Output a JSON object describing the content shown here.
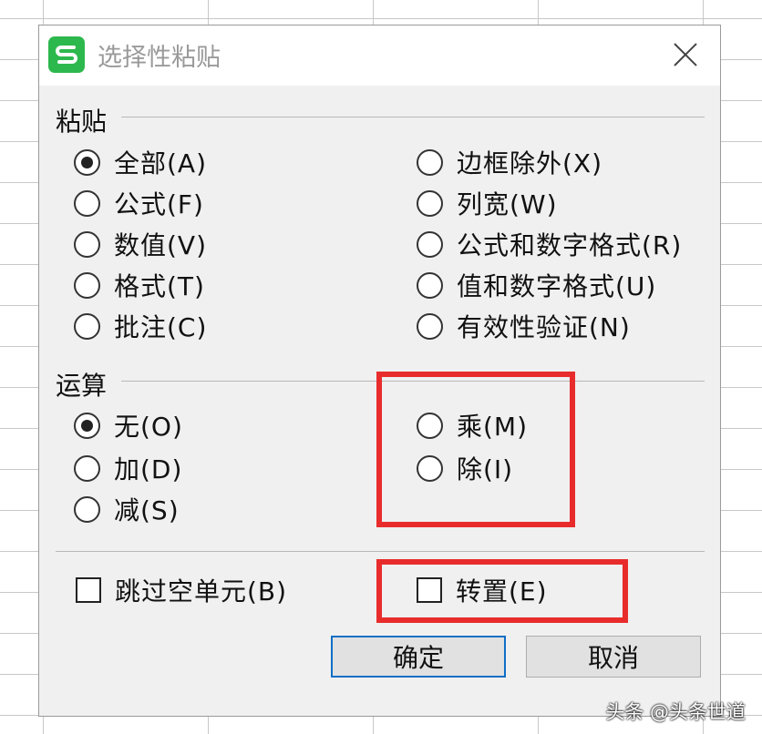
{
  "dialog": {
    "title": "选择性粘贴",
    "icon": "wps-spreadsheet-icon",
    "close_icon": "close-icon"
  },
  "paste": {
    "label": "粘贴",
    "options_left": [
      {
        "label": "全部(A)",
        "checked": true
      },
      {
        "label": "公式(F)",
        "checked": false
      },
      {
        "label": "数值(V)",
        "checked": false
      },
      {
        "label": "格式(T)",
        "checked": false
      },
      {
        "label": "批注(C)",
        "checked": false
      }
    ],
    "options_right": [
      {
        "label": "边框除外(X)",
        "checked": false
      },
      {
        "label": "列宽(W)",
        "checked": false
      },
      {
        "label": "公式和数字格式(R)",
        "checked": false
      },
      {
        "label": "值和数字格式(U)",
        "checked": false
      },
      {
        "label": "有效性验证(N)",
        "checked": false
      }
    ]
  },
  "operation": {
    "label": "运算",
    "options_left": [
      {
        "label": "无(O)",
        "checked": true
      },
      {
        "label": "加(D)",
        "checked": false
      },
      {
        "label": "减(S)",
        "checked": false
      }
    ],
    "options_right": [
      {
        "label": "乘(M)",
        "checked": false
      },
      {
        "label": "除(I)",
        "checked": false
      }
    ]
  },
  "checkboxes": {
    "skip_blanks": {
      "label": "跳过空单元(B)",
      "checked": false
    },
    "transpose": {
      "label": "转置(E)",
      "checked": false
    }
  },
  "buttons": {
    "ok": "确定",
    "cancel": "取消"
  },
  "colors": {
    "highlight": "#e82c2c",
    "app_icon": "#2db84d",
    "primary_border": "#0f6fc6"
  },
  "watermark": "头条 @头条世道"
}
